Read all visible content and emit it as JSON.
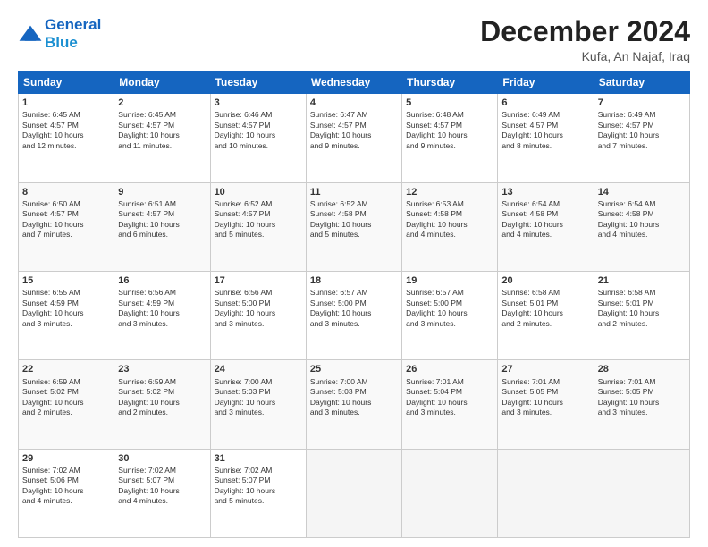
{
  "header": {
    "logo_line1": "General",
    "logo_line2": "Blue",
    "month_title": "December 2024",
    "location": "Kufa, An Najaf, Iraq"
  },
  "weekdays": [
    "Sunday",
    "Monday",
    "Tuesday",
    "Wednesday",
    "Thursday",
    "Friday",
    "Saturday"
  ],
  "weeks": [
    [
      {
        "day": "1",
        "info": "Sunrise: 6:45 AM\nSunset: 4:57 PM\nDaylight: 10 hours\nand 12 minutes."
      },
      {
        "day": "2",
        "info": "Sunrise: 6:45 AM\nSunset: 4:57 PM\nDaylight: 10 hours\nand 11 minutes."
      },
      {
        "day": "3",
        "info": "Sunrise: 6:46 AM\nSunset: 4:57 PM\nDaylight: 10 hours\nand 10 minutes."
      },
      {
        "day": "4",
        "info": "Sunrise: 6:47 AM\nSunset: 4:57 PM\nDaylight: 10 hours\nand 9 minutes."
      },
      {
        "day": "5",
        "info": "Sunrise: 6:48 AM\nSunset: 4:57 PM\nDaylight: 10 hours\nand 9 minutes."
      },
      {
        "day": "6",
        "info": "Sunrise: 6:49 AM\nSunset: 4:57 PM\nDaylight: 10 hours\nand 8 minutes."
      },
      {
        "day": "7",
        "info": "Sunrise: 6:49 AM\nSunset: 4:57 PM\nDaylight: 10 hours\nand 7 minutes."
      }
    ],
    [
      {
        "day": "8",
        "info": "Sunrise: 6:50 AM\nSunset: 4:57 PM\nDaylight: 10 hours\nand 7 minutes."
      },
      {
        "day": "9",
        "info": "Sunrise: 6:51 AM\nSunset: 4:57 PM\nDaylight: 10 hours\nand 6 minutes."
      },
      {
        "day": "10",
        "info": "Sunrise: 6:52 AM\nSunset: 4:57 PM\nDaylight: 10 hours\nand 5 minutes."
      },
      {
        "day": "11",
        "info": "Sunrise: 6:52 AM\nSunset: 4:58 PM\nDaylight: 10 hours\nand 5 minutes."
      },
      {
        "day": "12",
        "info": "Sunrise: 6:53 AM\nSunset: 4:58 PM\nDaylight: 10 hours\nand 4 minutes."
      },
      {
        "day": "13",
        "info": "Sunrise: 6:54 AM\nSunset: 4:58 PM\nDaylight: 10 hours\nand 4 minutes."
      },
      {
        "day": "14",
        "info": "Sunrise: 6:54 AM\nSunset: 4:58 PM\nDaylight: 10 hours\nand 4 minutes."
      }
    ],
    [
      {
        "day": "15",
        "info": "Sunrise: 6:55 AM\nSunset: 4:59 PM\nDaylight: 10 hours\nand 3 minutes."
      },
      {
        "day": "16",
        "info": "Sunrise: 6:56 AM\nSunset: 4:59 PM\nDaylight: 10 hours\nand 3 minutes."
      },
      {
        "day": "17",
        "info": "Sunrise: 6:56 AM\nSunset: 5:00 PM\nDaylight: 10 hours\nand 3 minutes."
      },
      {
        "day": "18",
        "info": "Sunrise: 6:57 AM\nSunset: 5:00 PM\nDaylight: 10 hours\nand 3 minutes."
      },
      {
        "day": "19",
        "info": "Sunrise: 6:57 AM\nSunset: 5:00 PM\nDaylight: 10 hours\nand 3 minutes."
      },
      {
        "day": "20",
        "info": "Sunrise: 6:58 AM\nSunset: 5:01 PM\nDaylight: 10 hours\nand 2 minutes."
      },
      {
        "day": "21",
        "info": "Sunrise: 6:58 AM\nSunset: 5:01 PM\nDaylight: 10 hours\nand 2 minutes."
      }
    ],
    [
      {
        "day": "22",
        "info": "Sunrise: 6:59 AM\nSunset: 5:02 PM\nDaylight: 10 hours\nand 2 minutes."
      },
      {
        "day": "23",
        "info": "Sunrise: 6:59 AM\nSunset: 5:02 PM\nDaylight: 10 hours\nand 2 minutes."
      },
      {
        "day": "24",
        "info": "Sunrise: 7:00 AM\nSunset: 5:03 PM\nDaylight: 10 hours\nand 3 minutes."
      },
      {
        "day": "25",
        "info": "Sunrise: 7:00 AM\nSunset: 5:03 PM\nDaylight: 10 hours\nand 3 minutes."
      },
      {
        "day": "26",
        "info": "Sunrise: 7:01 AM\nSunset: 5:04 PM\nDaylight: 10 hours\nand 3 minutes."
      },
      {
        "day": "27",
        "info": "Sunrise: 7:01 AM\nSunset: 5:05 PM\nDaylight: 10 hours\nand 3 minutes."
      },
      {
        "day": "28",
        "info": "Sunrise: 7:01 AM\nSunset: 5:05 PM\nDaylight: 10 hours\nand 3 minutes."
      }
    ],
    [
      {
        "day": "29",
        "info": "Sunrise: 7:02 AM\nSunset: 5:06 PM\nDaylight: 10 hours\nand 4 minutes."
      },
      {
        "day": "30",
        "info": "Sunrise: 7:02 AM\nSunset: 5:07 PM\nDaylight: 10 hours\nand 4 minutes."
      },
      {
        "day": "31",
        "info": "Sunrise: 7:02 AM\nSunset: 5:07 PM\nDaylight: 10 hours\nand 5 minutes."
      },
      {
        "day": "",
        "info": ""
      },
      {
        "day": "",
        "info": ""
      },
      {
        "day": "",
        "info": ""
      },
      {
        "day": "",
        "info": ""
      }
    ]
  ]
}
